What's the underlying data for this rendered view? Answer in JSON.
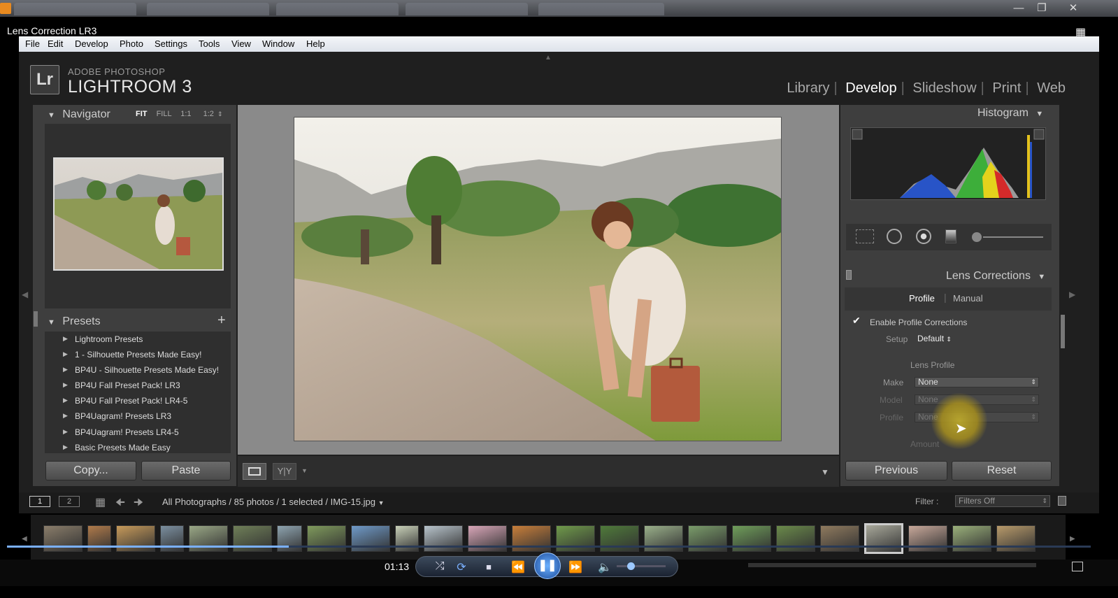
{
  "window": {
    "title": "Lens Correction LR3",
    "minimize": "—",
    "maximize": "❐",
    "close": "✕"
  },
  "menu": [
    "File",
    "Edit",
    "Develop",
    "Photo",
    "Settings",
    "Tools",
    "View",
    "Window",
    "Help"
  ],
  "brand": {
    "icon": "Lr",
    "line1": "ADOBE PHOTOSHOP",
    "line2": "LIGHTROOM 3"
  },
  "modules": [
    {
      "label": "Library"
    },
    {
      "label": "Develop",
      "active": true
    },
    {
      "label": "Slideshow"
    },
    {
      "label": "Print"
    },
    {
      "label": "Web"
    }
  ],
  "navigator": {
    "title": "Navigator",
    "zoom": [
      "FIT",
      "FILL",
      "1:1",
      "1:2"
    ]
  },
  "presets": {
    "title": "Presets",
    "add": "+",
    "items": [
      "Lightroom Presets",
      "1 - Silhouette Presets Made Easy!",
      "BP4U - Silhouette Presets Made Easy!",
      "BP4U Fall Preset Pack! LR3",
      "BP4U Fall Preset Pack! LR4-5",
      "BP4Uagram! Presets LR3",
      "BP4Uagram! Presets LR4-5",
      "Basic Presets Made Easy"
    ]
  },
  "leftButtons": {
    "copy": "Copy...",
    "paste": "Paste"
  },
  "histogram": {
    "title": "Histogram"
  },
  "lens": {
    "title": "Lens Corrections",
    "tabs": [
      "Profile",
      "Manual"
    ],
    "enable": "Enable Profile Corrections",
    "check": "✔",
    "setupLabel": "Setup",
    "setupValue": "Default",
    "lensProfileTitle": "Lens Profile",
    "makeLabel": "Make",
    "makeValue": "None",
    "modelLabel": "Model",
    "modelValue": "None",
    "profileLabel": "Profile",
    "profileValue": "None",
    "amountLabel": "Amount"
  },
  "rightButtons": {
    "previous": "Previous",
    "reset": "Reset"
  },
  "filmbar": {
    "screen1": "1",
    "screen2": "2",
    "source": "All Photographs / 85 photos / 1 selected / IMG-15.jpg",
    "filterLabel": "Filter :",
    "filterValue": "Filters Off"
  },
  "player": {
    "time": "01:13",
    "progress": 0.26
  },
  "colors": {
    "accent": "#7ab0ff",
    "panel": "#3e3e3e",
    "background": "#1f1f1f"
  }
}
